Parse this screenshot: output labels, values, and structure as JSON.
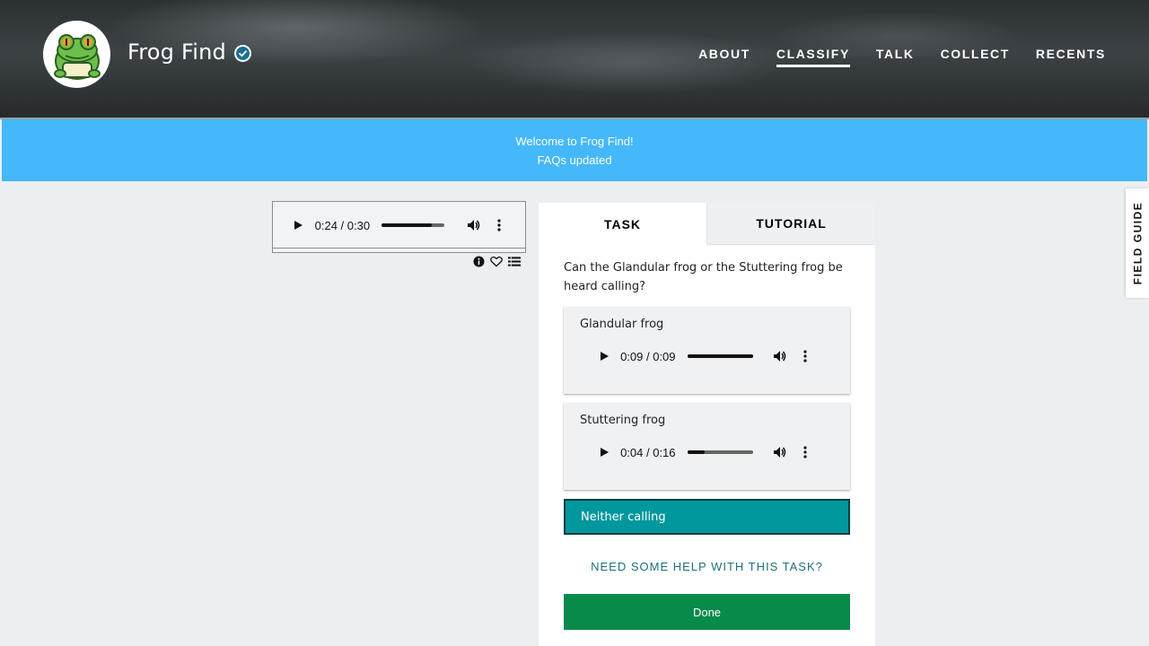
{
  "header": {
    "brand": "Frog Find",
    "nav": [
      {
        "label": "ABOUT",
        "active": false
      },
      {
        "label": "CLASSIFY",
        "active": true
      },
      {
        "label": "TALK",
        "active": false
      },
      {
        "label": "COLLECT",
        "active": false
      },
      {
        "label": "RECENTS",
        "active": false
      }
    ]
  },
  "banner": {
    "line1": "Welcome to Frog Find!",
    "line2": "FAQs updated"
  },
  "subject_audio": {
    "time": "0:24 / 0:30",
    "progress": 0.8
  },
  "subject_meta_icons": [
    "info-icon",
    "heart-icon",
    "collection-list-icon"
  ],
  "panel": {
    "tabs": [
      {
        "label": "TASK",
        "active": true
      },
      {
        "label": "TUTORIAL",
        "active": false
      }
    ],
    "question": "Can the Glandular frog or the Stuttering frog be heard calling?",
    "answers": [
      {
        "label": "Glandular frog",
        "time": "0:09 / 0:09",
        "progress": 1.0
      },
      {
        "label": "Stuttering frog",
        "time": "0:04 / 0:16",
        "progress": 0.25
      }
    ],
    "neither_label": "Neither calling",
    "help_label": "NEED SOME HELP WITH THIS TASK?",
    "done_label": "Done"
  },
  "field_guide_label": "FIELD GUIDE",
  "colors": {
    "banner": "#44b8fb",
    "neither": "#00979d",
    "done": "#078a4a",
    "help_text": "#1f6f7a"
  }
}
